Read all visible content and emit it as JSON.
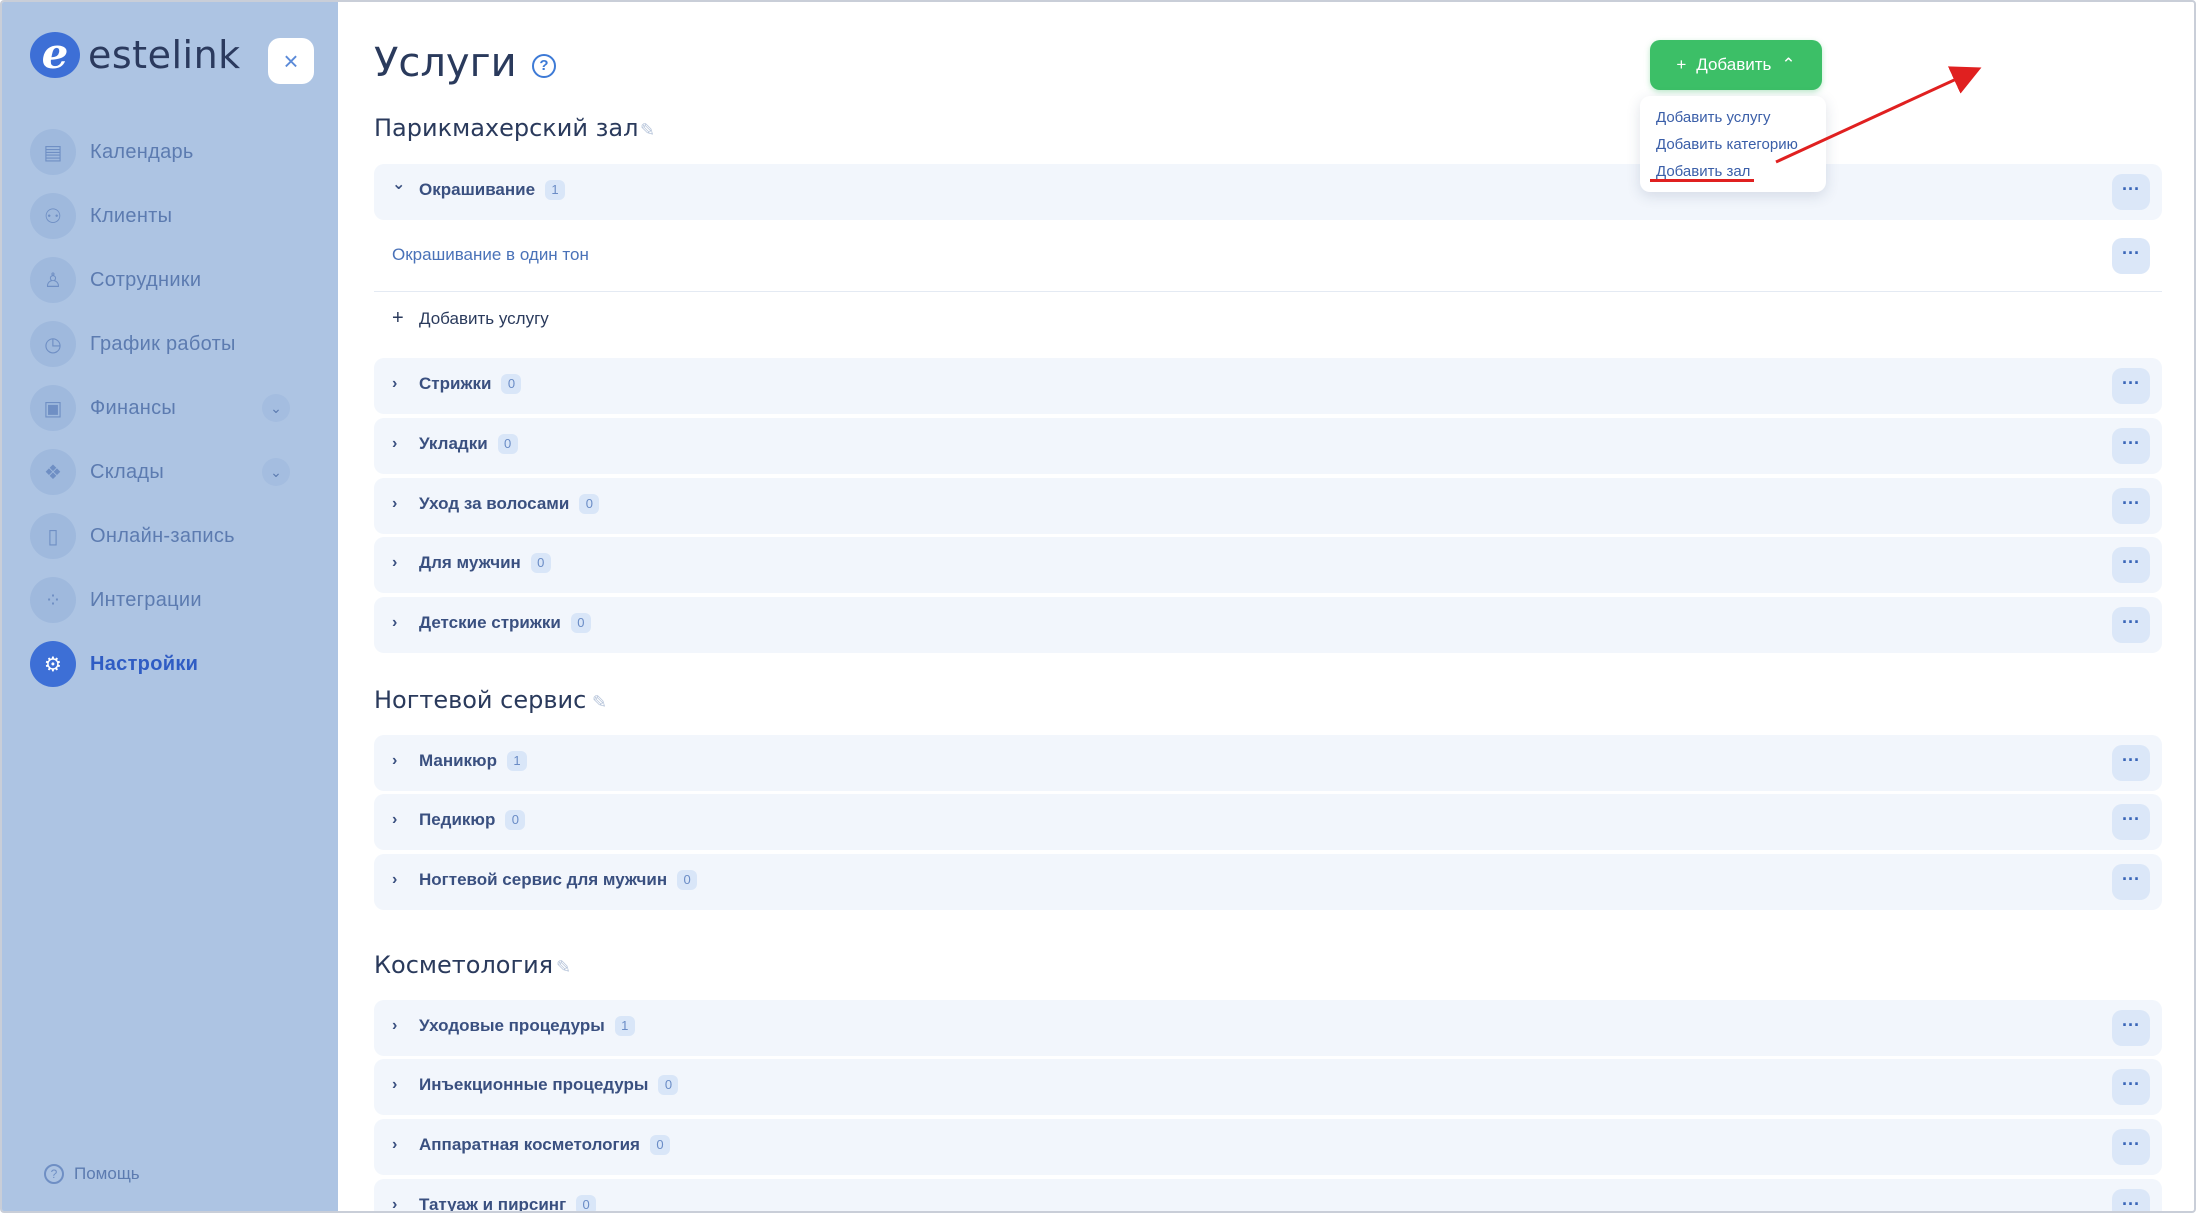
{
  "brand": {
    "logo_letter": "e",
    "name": "estelink"
  },
  "sidebar": {
    "close_symbol": "×",
    "items": [
      {
        "label": "Календарь",
        "icon": "calendar-icon",
        "glyph": "▤"
      },
      {
        "label": "Клиенты",
        "icon": "clients-icon",
        "glyph": "⚇"
      },
      {
        "label": "Сотрудники",
        "icon": "employee-icon",
        "glyph": "♙"
      },
      {
        "label": "График работы",
        "icon": "clock-icon",
        "glyph": "◷"
      },
      {
        "label": "Финансы",
        "icon": "wallet-icon",
        "glyph": "▣"
      },
      {
        "label": "Склады",
        "icon": "warehouse-icon",
        "glyph": "❖"
      },
      {
        "label": "Онлайн-запись",
        "icon": "phone-icon",
        "glyph": "▯"
      },
      {
        "label": "Интеграции",
        "icon": "integrations-icon",
        "glyph": "⁘"
      },
      {
        "label": "Настройки",
        "icon": "settings-icon",
        "glyph": "⚙"
      }
    ],
    "active_item": "Настройки",
    "help_label": "Помощь"
  },
  "header": {
    "title": "Услуги",
    "help_symbol": "?",
    "add_button_label": "Добавить",
    "add_button_plus": "+",
    "add_button_caret": "⌃"
  },
  "dropdown": {
    "items": [
      "Добавить услугу",
      "Добавить категорию",
      "Добавить зал"
    ],
    "highlighted": "Добавить зал"
  },
  "sections": [
    {
      "title": "Парикмахерский зал",
      "categories": [
        {
          "name": "Окрашивание",
          "count": "1",
          "expanded": true,
          "services": [
            "Окрашивание в один тон"
          ],
          "add_label": "Добавить услугу"
        },
        {
          "name": "Стрижки",
          "count": "0"
        },
        {
          "name": "Укладки",
          "count": "0"
        },
        {
          "name": "Уход за волосами",
          "count": "0"
        },
        {
          "name": "Для мужчин",
          "count": "0"
        },
        {
          "name": "Детские стрижки",
          "count": "0"
        }
      ]
    },
    {
      "title": "Ногтевой сервис",
      "categories": [
        {
          "name": "Маникюр",
          "count": "1"
        },
        {
          "name": "Педикюр",
          "count": "0"
        },
        {
          "name": "Ногтевой сервис для мужчин",
          "count": "0"
        }
      ]
    },
    {
      "title": "Косметология",
      "categories": [
        {
          "name": "Уходовые процедуры",
          "count": "1"
        },
        {
          "name": "Инъекционные процедуры",
          "count": "0"
        },
        {
          "name": "Аппаратная косметология",
          "count": "0"
        },
        {
          "name": "Татуаж и пирсинг",
          "count": "0"
        }
      ]
    }
  ],
  "symbols": {
    "chevron_right": "›",
    "chevron_down": "⌄",
    "more": "···",
    "pencil": "✎",
    "plus": "+"
  },
  "colors": {
    "accent_green": "#3cbf67",
    "accent_blue": "#3d6fd6",
    "annotation_red": "#e02020"
  }
}
